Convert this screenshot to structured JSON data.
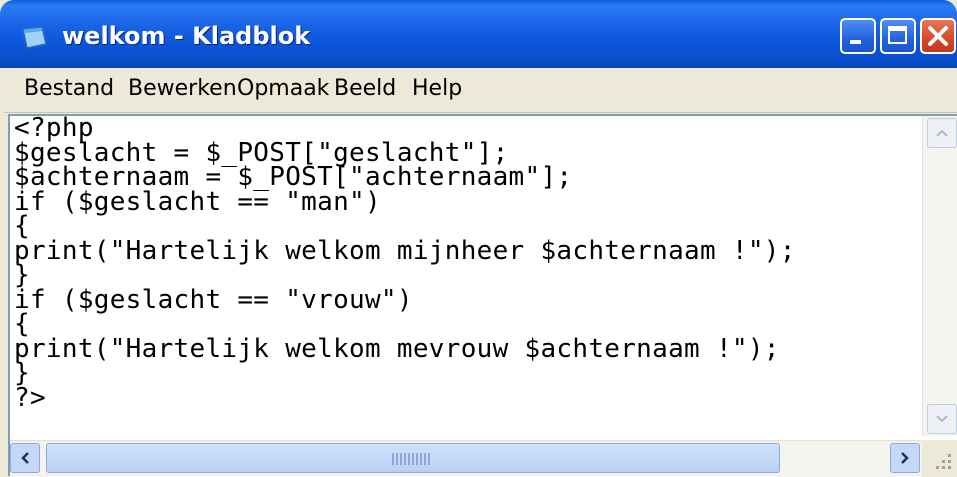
{
  "window": {
    "title": "welkom - Kladblok",
    "app_icon": "notepad-icon"
  },
  "menu": [
    {
      "label": "Bestand"
    },
    {
      "label": "Bewerken"
    },
    {
      "label": "Opmaak"
    },
    {
      "label": "Beeld"
    },
    {
      "label": "Help"
    }
  ],
  "editor": {
    "lines": [
      "<?php",
      "$geslacht = $_POST[\"geslacht\"];",
      "$achternaam = $_POST[\"achternaam\"];",
      "if ($geslacht == \"man\")",
      "{",
      "print(\"Hartelijk welkom mijnheer $achternaam !\");",
      "}",
      "if ($geslacht == \"vrouw\")",
      "{",
      "print(\"Hartelijk welkom mevrouw $achternaam !\");",
      "}",
      "?>"
    ]
  },
  "colors": {
    "titlebar": "#0b55d8",
    "close_button": "#d4472a",
    "menubar": "#ece9d8",
    "editor_bg": "#ffffff"
  }
}
